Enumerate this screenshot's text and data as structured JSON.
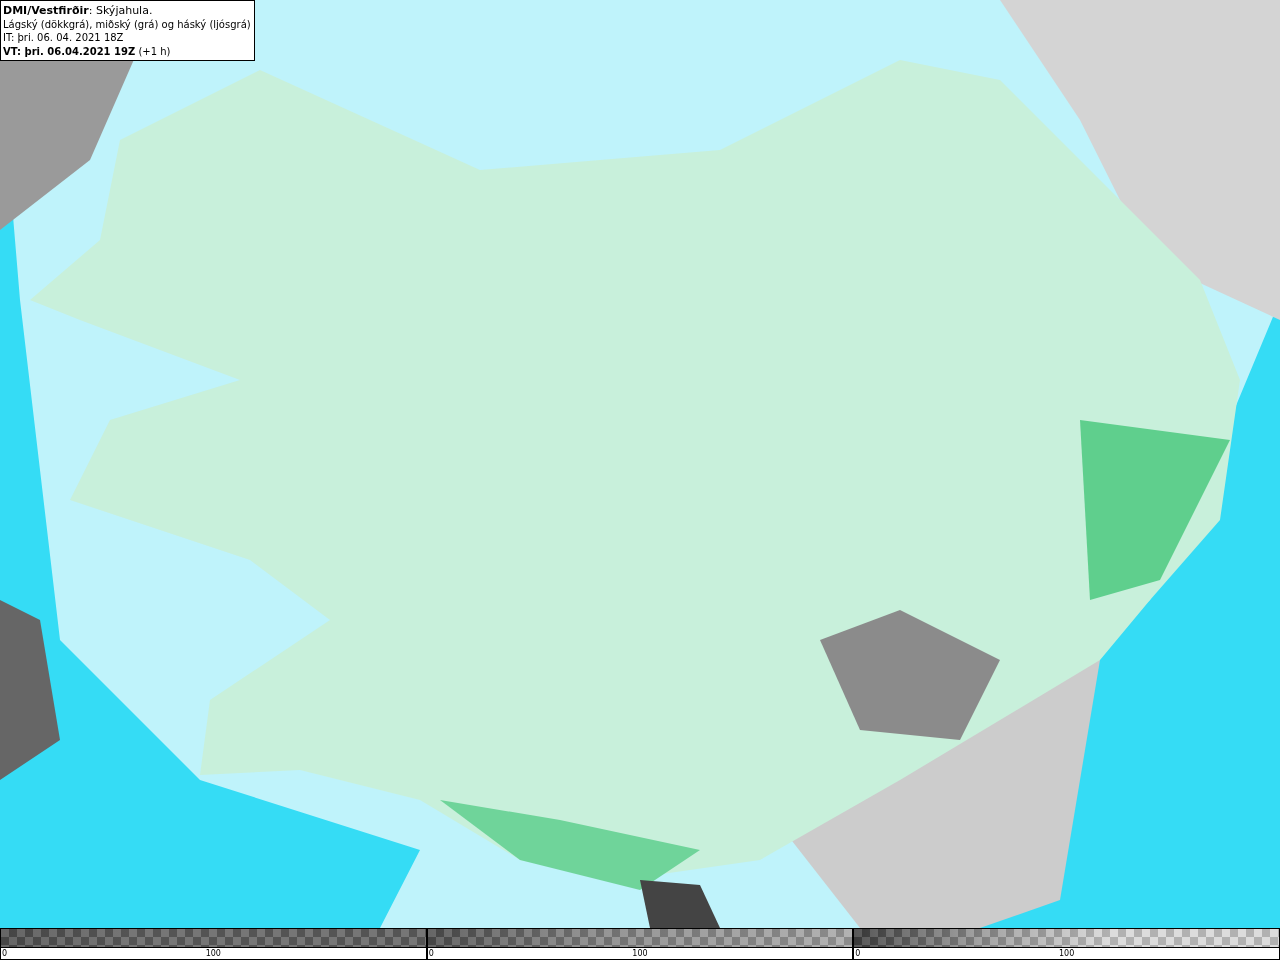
{
  "legend": {
    "title": "**DMI/Vestfirðir**: Skýjahula.",
    "subtitle": "Lágský (dökkgrá), miðský (grá) og háský (ljósgrá)",
    "issue_time": "IT: þri. 06. 04. 2021 18Z",
    "valid_time": "**VT: þri. 06.04.2021 19Z** (+1 h)"
  },
  "colorbars": [
    {
      "kind": "low",
      "min_label": "0",
      "mid_label": "100"
    },
    {
      "kind": "mid",
      "min_label": "0",
      "mid_label": "100"
    },
    {
      "kind": "high",
      "min_label": "0",
      "mid_label": "100"
    }
  ]
}
